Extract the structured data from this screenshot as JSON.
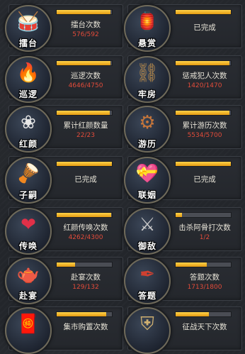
{
  "colors": {
    "progress_fill": "#f0b22a",
    "count_text": "#e24b3a",
    "title_text": "#e6e2d6"
  },
  "cards": [
    {
      "icon": "drum-icon",
      "name": "擂台",
      "title": "擂台次数",
      "count": "576/592",
      "progress": 0.97,
      "done": false
    },
    {
      "icon": "shop-sign-icon",
      "name": "悬赏",
      "title": "已完成",
      "count": "",
      "progress": 1.0,
      "done": true
    },
    {
      "icon": "torch-icon",
      "name": "巡逻",
      "title": "巡逻次数",
      "count": "4646/4750",
      "progress": 0.98,
      "done": false
    },
    {
      "icon": "shackle-icon",
      "name": "牢房",
      "title": "惩戒犯人次数",
      "count": "1420/1470",
      "progress": 0.97,
      "done": false
    },
    {
      "icon": "flower-icon",
      "name": "红颜",
      "title": "累计红颜数量",
      "count": "22/23",
      "progress": 0.96,
      "done": false
    },
    {
      "icon": "carriage-icon",
      "name": "游历",
      "title": "累计游历次数",
      "count": "5534/5700",
      "progress": 0.97,
      "done": false
    },
    {
      "icon": "rattle-drum-icon",
      "name": "子嗣",
      "title": "已完成",
      "count": "",
      "progress": 1.0,
      "done": true
    },
    {
      "icon": "gift-heart-icon",
      "name": "联姻",
      "title": "已完成",
      "count": "",
      "progress": 1.0,
      "done": true
    },
    {
      "icon": "hearts-icon",
      "name": "传唤",
      "title": "红颜传唤次数",
      "count": "4262/4300",
      "progress": 0.99,
      "done": false
    },
    {
      "icon": "battle-axe-icon",
      "name": "御敌",
      "title": "击杀阿骨打次数",
      "count": "1/2",
      "progress": 0.5,
      "done": false
    },
    {
      "icon": "teapot-icon",
      "name": "赴宴",
      "title": "赴宴次数",
      "count": "129/132",
      "progress": 0.98,
      "done": false
    },
    {
      "icon": "brush-scroll-icon",
      "name": "答题",
      "title": "答题次数",
      "count": "1713/1800",
      "progress": 0.95,
      "done": false
    },
    {
      "icon": "red-envelope-icon",
      "name": "",
      "title": "集市购置次数",
      "count": "",
      "progress": 0.9,
      "done": false
    },
    {
      "icon": "war-helmet-icon",
      "name": "",
      "title": "征战天下次数",
      "count": "",
      "progress": 0.6,
      "done": false
    }
  ]
}
